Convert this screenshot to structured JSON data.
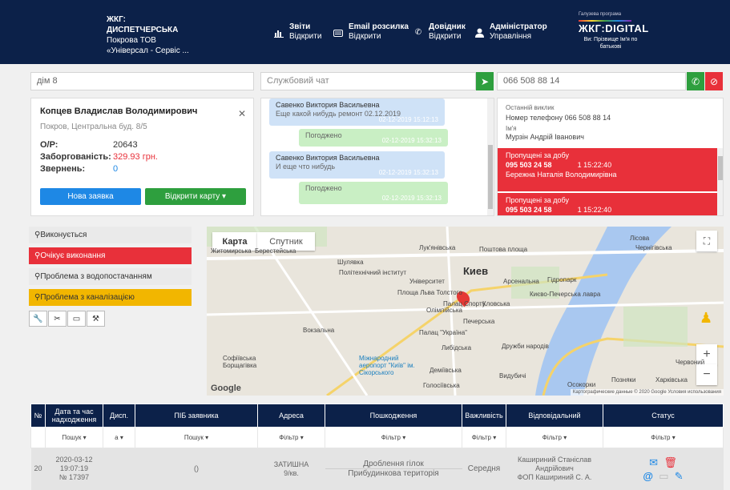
{
  "header": {
    "org_title": "ЖКГ:",
    "org_subtitle": "ДИСПЕТЧЕРСЬКА",
    "org_company": "Покрова ТОВ",
    "org_extra": "«Універсал - Сервіс ...",
    "nav": [
      {
        "title": "Звіти",
        "sub": "Відкрити",
        "icon": "chart-icon"
      },
      {
        "title": "Email розсилка",
        "sub": "Відкрити",
        "icon": "envelope-icon"
      },
      {
        "title": "Довідник",
        "sub": "Відкрити",
        "icon": "phone-icon"
      },
      {
        "title": "Адміністратор",
        "sub": "Управління",
        "icon": "user-icon"
      }
    ],
    "logo_program": "Галузева програма",
    "logo_brand": "ЖКГ:DIGITAL",
    "user_label": "Ви: Прізвище Ім'я по батькові"
  },
  "search": {
    "house": "дім 8",
    "chat_placeholder": "Службовий чат",
    "phone": "066 508 88 14"
  },
  "card": {
    "name": "Копцев Владислав Володимирович",
    "address": "Покров, Центральна буд. 8/5",
    "account_label": "О/Р:",
    "account": "20643",
    "debt_label": "Заборгованість:",
    "debt": "329.93 грн.",
    "requests_label": "Звернень:",
    "requests": "0",
    "new_request": "Нова заявка",
    "open_card": "Відкрити карту"
  },
  "chat": [
    {
      "side": "in",
      "author": "Савенко Виктория Васильевна",
      "text": "Еще какой нибудь ремонт 02.12.2019",
      "time": "02-12-2019 15:12:13"
    },
    {
      "side": "out",
      "text": "Погоджено",
      "time": "02-12-2019 15:32:13"
    },
    {
      "side": "in",
      "author": "Савенко Виктория Васильевна",
      "text": "И еще что нибудь",
      "time": "02-12-2019 15:32:13"
    },
    {
      "side": "out",
      "text": "Погоджено",
      "time": "02-12-2019 15:32:13"
    }
  ],
  "calls": {
    "last_label": "Останній виклик",
    "phone_line": "Номер телефону 066 508 88 14",
    "name_label": "Ім'я",
    "name": "Мурзін Андрій Іванович",
    "missed": [
      {
        "title": "Пропущені за добу",
        "phone": "095 503 24 58",
        "time": "1 15:22:40",
        "name": "Бережна Наталія Володимирівна"
      },
      {
        "title": "Пропущені за добу",
        "phone": "095 503 24 58",
        "time": "1 15:22:40"
      }
    ]
  },
  "statuses": [
    {
      "label": "Виконується",
      "color": "#eaeaea",
      "text": "#333"
    },
    {
      "label": "Очікує виконання",
      "color": "#e8303a",
      "text": "#fff"
    },
    {
      "label": "Проблема з водопостачанням",
      "color": "#eaeaea",
      "text": "#333"
    },
    {
      "label": "Проблема з каналізацією",
      "color": "#f2b600",
      "text": "#333"
    }
  ],
  "map": {
    "tab_map": "Карта",
    "tab_sat": "Спутник",
    "city": "Киев",
    "labels": [
      "Лук'янівська",
      "Поштова площа",
      "Житомирська",
      "Політехнічний інститут",
      "Університет",
      "Арсенальна",
      "Площа Льва Толстого",
      "Палац Спорту",
      "Олімпійська",
      "Кловська",
      "Києво-Печерська лавра",
      "Печерська",
      "Палац \"Україна\"",
      "Либідська",
      "Дружби народів",
      "Міжнародний аеропорт \"Київ\" ім. Сікорського",
      "Деміївська",
      "Голосіївська",
      "Видубичі",
      "Осокорки",
      "Позняки",
      "Харківська",
      "Лісова",
      "Чернігівська",
      "Гідропарк",
      "Шулявка",
      "Вокзальна",
      "Берестейська",
      "Софіївська Борщагівка",
      "Червоний"
    ],
    "footer": "Картографические данные © 2020 Google   Условия использования",
    "google": "Google"
  },
  "table": {
    "headers": [
      "№",
      "Дата та час надходження",
      "Дисп.",
      "ПІБ заявника",
      "Адреса",
      "Пошкодження",
      "Важливість",
      "Відповідальний",
      "Статус"
    ],
    "filters": [
      "",
      "Пошук ▾",
      "а ▾",
      "Пошук ▾",
      "Фільтр ▾",
      "Фільтр ▾",
      "Фільтр ▾",
      "Фільтр ▾",
      "Фільтр ▾"
    ],
    "rows": [
      {
        "num": "20",
        "date": "2020-03-12",
        "time": "19:07:19",
        "nr": "№ 17397",
        "disp": "",
        "name": "()",
        "addr1": "ЗАТИШНА",
        "addr2": "9/кв.",
        "dmg1": "Дроблення гілок",
        "dmg2": "Прибудинкова територія",
        "importance": "Середня",
        "resp1": "Кашириний Станіслав",
        "resp2": "Андрійович",
        "resp3": "ФОП Кашириний С. А."
      }
    ]
  },
  "colors": {
    "navy": "#0c2149",
    "blue": "#1e88e5",
    "green": "#2e9f3e",
    "red": "#e8303a",
    "amber": "#f2b600"
  }
}
